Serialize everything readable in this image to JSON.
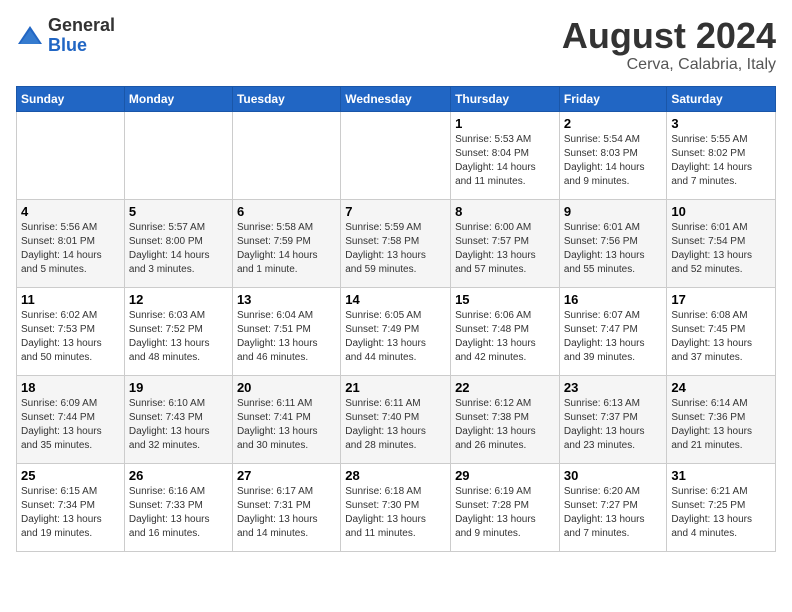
{
  "header": {
    "logo_general": "General",
    "logo_blue": "Blue",
    "month_year": "August 2024",
    "location": "Cerva, Calabria, Italy"
  },
  "weekdays": [
    "Sunday",
    "Monday",
    "Tuesday",
    "Wednesday",
    "Thursday",
    "Friday",
    "Saturday"
  ],
  "weeks": [
    [
      {
        "day": "",
        "info": ""
      },
      {
        "day": "",
        "info": ""
      },
      {
        "day": "",
        "info": ""
      },
      {
        "day": "",
        "info": ""
      },
      {
        "day": "1",
        "info": "Sunrise: 5:53 AM\nSunset: 8:04 PM\nDaylight: 14 hours\nand 11 minutes."
      },
      {
        "day": "2",
        "info": "Sunrise: 5:54 AM\nSunset: 8:03 PM\nDaylight: 14 hours\nand 9 minutes."
      },
      {
        "day": "3",
        "info": "Sunrise: 5:55 AM\nSunset: 8:02 PM\nDaylight: 14 hours\nand 7 minutes."
      }
    ],
    [
      {
        "day": "4",
        "info": "Sunrise: 5:56 AM\nSunset: 8:01 PM\nDaylight: 14 hours\nand 5 minutes."
      },
      {
        "day": "5",
        "info": "Sunrise: 5:57 AM\nSunset: 8:00 PM\nDaylight: 14 hours\nand 3 minutes."
      },
      {
        "day": "6",
        "info": "Sunrise: 5:58 AM\nSunset: 7:59 PM\nDaylight: 14 hours\nand 1 minute."
      },
      {
        "day": "7",
        "info": "Sunrise: 5:59 AM\nSunset: 7:58 PM\nDaylight: 13 hours\nand 59 minutes."
      },
      {
        "day": "8",
        "info": "Sunrise: 6:00 AM\nSunset: 7:57 PM\nDaylight: 13 hours\nand 57 minutes."
      },
      {
        "day": "9",
        "info": "Sunrise: 6:01 AM\nSunset: 7:56 PM\nDaylight: 13 hours\nand 55 minutes."
      },
      {
        "day": "10",
        "info": "Sunrise: 6:01 AM\nSunset: 7:54 PM\nDaylight: 13 hours\nand 52 minutes."
      }
    ],
    [
      {
        "day": "11",
        "info": "Sunrise: 6:02 AM\nSunset: 7:53 PM\nDaylight: 13 hours\nand 50 minutes."
      },
      {
        "day": "12",
        "info": "Sunrise: 6:03 AM\nSunset: 7:52 PM\nDaylight: 13 hours\nand 48 minutes."
      },
      {
        "day": "13",
        "info": "Sunrise: 6:04 AM\nSunset: 7:51 PM\nDaylight: 13 hours\nand 46 minutes."
      },
      {
        "day": "14",
        "info": "Sunrise: 6:05 AM\nSunset: 7:49 PM\nDaylight: 13 hours\nand 44 minutes."
      },
      {
        "day": "15",
        "info": "Sunrise: 6:06 AM\nSunset: 7:48 PM\nDaylight: 13 hours\nand 42 minutes."
      },
      {
        "day": "16",
        "info": "Sunrise: 6:07 AM\nSunset: 7:47 PM\nDaylight: 13 hours\nand 39 minutes."
      },
      {
        "day": "17",
        "info": "Sunrise: 6:08 AM\nSunset: 7:45 PM\nDaylight: 13 hours\nand 37 minutes."
      }
    ],
    [
      {
        "day": "18",
        "info": "Sunrise: 6:09 AM\nSunset: 7:44 PM\nDaylight: 13 hours\nand 35 minutes."
      },
      {
        "day": "19",
        "info": "Sunrise: 6:10 AM\nSunset: 7:43 PM\nDaylight: 13 hours\nand 32 minutes."
      },
      {
        "day": "20",
        "info": "Sunrise: 6:11 AM\nSunset: 7:41 PM\nDaylight: 13 hours\nand 30 minutes."
      },
      {
        "day": "21",
        "info": "Sunrise: 6:11 AM\nSunset: 7:40 PM\nDaylight: 13 hours\nand 28 minutes."
      },
      {
        "day": "22",
        "info": "Sunrise: 6:12 AM\nSunset: 7:38 PM\nDaylight: 13 hours\nand 26 minutes."
      },
      {
        "day": "23",
        "info": "Sunrise: 6:13 AM\nSunset: 7:37 PM\nDaylight: 13 hours\nand 23 minutes."
      },
      {
        "day": "24",
        "info": "Sunrise: 6:14 AM\nSunset: 7:36 PM\nDaylight: 13 hours\nand 21 minutes."
      }
    ],
    [
      {
        "day": "25",
        "info": "Sunrise: 6:15 AM\nSunset: 7:34 PM\nDaylight: 13 hours\nand 19 minutes."
      },
      {
        "day": "26",
        "info": "Sunrise: 6:16 AM\nSunset: 7:33 PM\nDaylight: 13 hours\nand 16 minutes."
      },
      {
        "day": "27",
        "info": "Sunrise: 6:17 AM\nSunset: 7:31 PM\nDaylight: 13 hours\nand 14 minutes."
      },
      {
        "day": "28",
        "info": "Sunrise: 6:18 AM\nSunset: 7:30 PM\nDaylight: 13 hours\nand 11 minutes."
      },
      {
        "day": "29",
        "info": "Sunrise: 6:19 AM\nSunset: 7:28 PM\nDaylight: 13 hours\nand 9 minutes."
      },
      {
        "day": "30",
        "info": "Sunrise: 6:20 AM\nSunset: 7:27 PM\nDaylight: 13 hours\nand 7 minutes."
      },
      {
        "day": "31",
        "info": "Sunrise: 6:21 AM\nSunset: 7:25 PM\nDaylight: 13 hours\nand 4 minutes."
      }
    ]
  ]
}
